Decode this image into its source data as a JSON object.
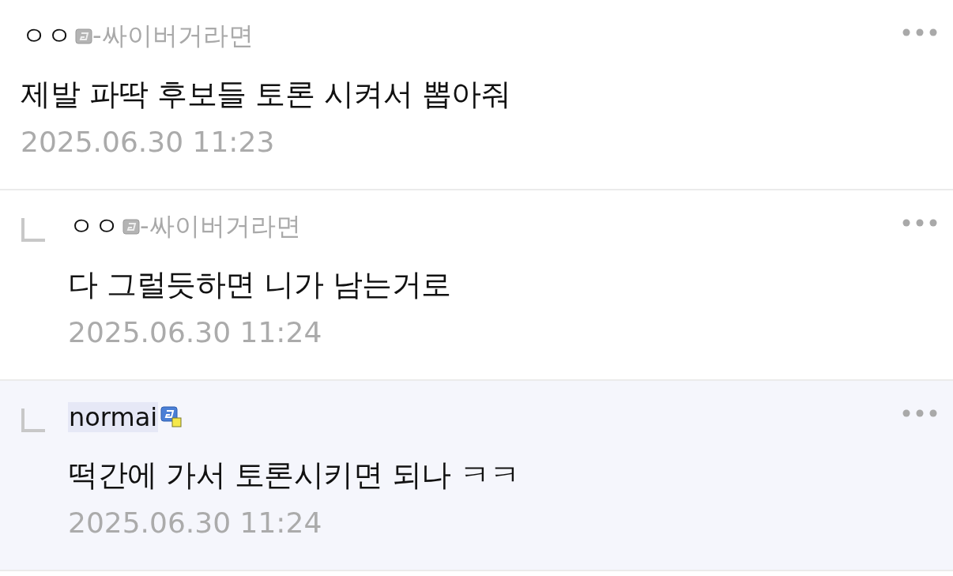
{
  "comments": [
    {
      "reply": false,
      "highlighted": false,
      "author": "ㅇㅇ",
      "author_marked": false,
      "badge": {
        "kind": "plain"
      },
      "suffix": "-싸이버거라면",
      "text": "제발 파딱 후보들 토론 시켜서 뽑아줘",
      "time": "2025.06.30 11:23"
    },
    {
      "reply": true,
      "highlighted": false,
      "author": "ㅇㅇ",
      "author_marked": false,
      "badge": {
        "kind": "plain"
      },
      "suffix": "-싸이버거라면",
      "text": "다 그럴듯하면 니가 남는거로",
      "time": "2025.06.30 11:24"
    },
    {
      "reply": true,
      "highlighted": true,
      "author": "normai",
      "author_marked": true,
      "badge": {
        "kind": "fixed"
      },
      "text": "떡간에 가서 토론시키면 되나 ㅋㅋ",
      "time": "2025.06.30 11:24"
    }
  ]
}
